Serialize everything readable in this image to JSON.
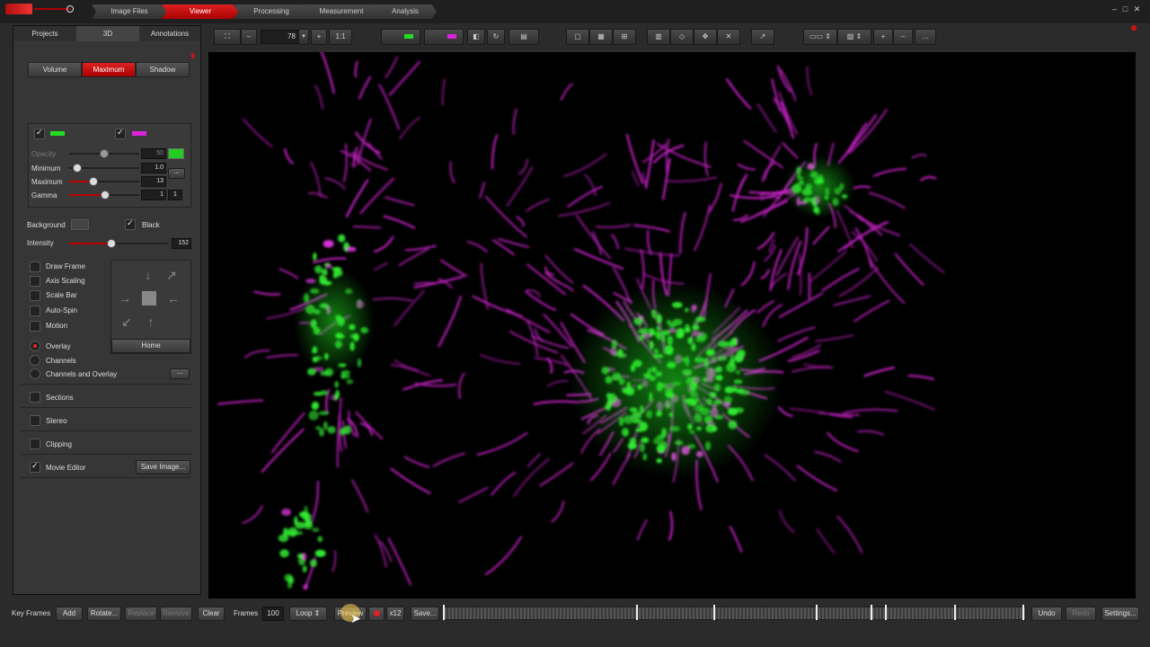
{
  "top_tabs": [
    "Image Files",
    "Viewer",
    "Processing",
    "Measurement",
    "Analysis"
  ],
  "active_top_tab": "Viewer",
  "window_buttons": [
    "–",
    "□",
    "✕"
  ],
  "left_tabs": [
    "Projects",
    "3D",
    "Annotations"
  ],
  "render_modes": [
    "Volume",
    "Maximum",
    "Shadow"
  ],
  "channel_settings": {
    "opacity_label": "Opacity",
    "opacity_value": "50",
    "minimum_label": "Minimum",
    "minimum_value": "1.0",
    "maximum_label": "Maximum",
    "maximum_value": "13",
    "gamma_label": "Gamma",
    "gamma_value": "1",
    "gamma_value2": "1",
    "more_button": "..."
  },
  "background": {
    "label": "Background",
    "black_label": "Black"
  },
  "intensity": {
    "label": "Intensity",
    "value": "152"
  },
  "options": [
    "Draw Frame",
    "Axis Scaling",
    "Scale Bar",
    "Auto-Spin",
    "Motion"
  ],
  "home_label": "Home",
  "display_modes": [
    "Overlay",
    "Channels",
    "Channels and Overlay"
  ],
  "display_more": "...",
  "sections_label": "Sections",
  "stereo_label": "Stereo",
  "clipping_label": "Clipping",
  "movie_editor_label": "Movie Editor",
  "save_image_label": "Save Image...",
  "zoom": {
    "minus": "–",
    "value": "78",
    "plus": "+",
    "one_to_one": "1:1"
  },
  "bottom": {
    "key_frames_label": "Key Frames",
    "add": "Add",
    "rotate": "Rotate...",
    "replace": "Replace",
    "remove": "Remove",
    "clear": "Clear",
    "frames_label": "Frames",
    "frames_value": "100",
    "loop": "Loop",
    "preview": "Preview",
    "speed": "x12",
    "save": "Save...",
    "undo": "Undo",
    "redo": "Redo",
    "settings": "Settings..."
  },
  "colors": {
    "accent": "#cc1111",
    "green_channel": "#22dd22",
    "magenta_channel": "#dd22dd"
  }
}
